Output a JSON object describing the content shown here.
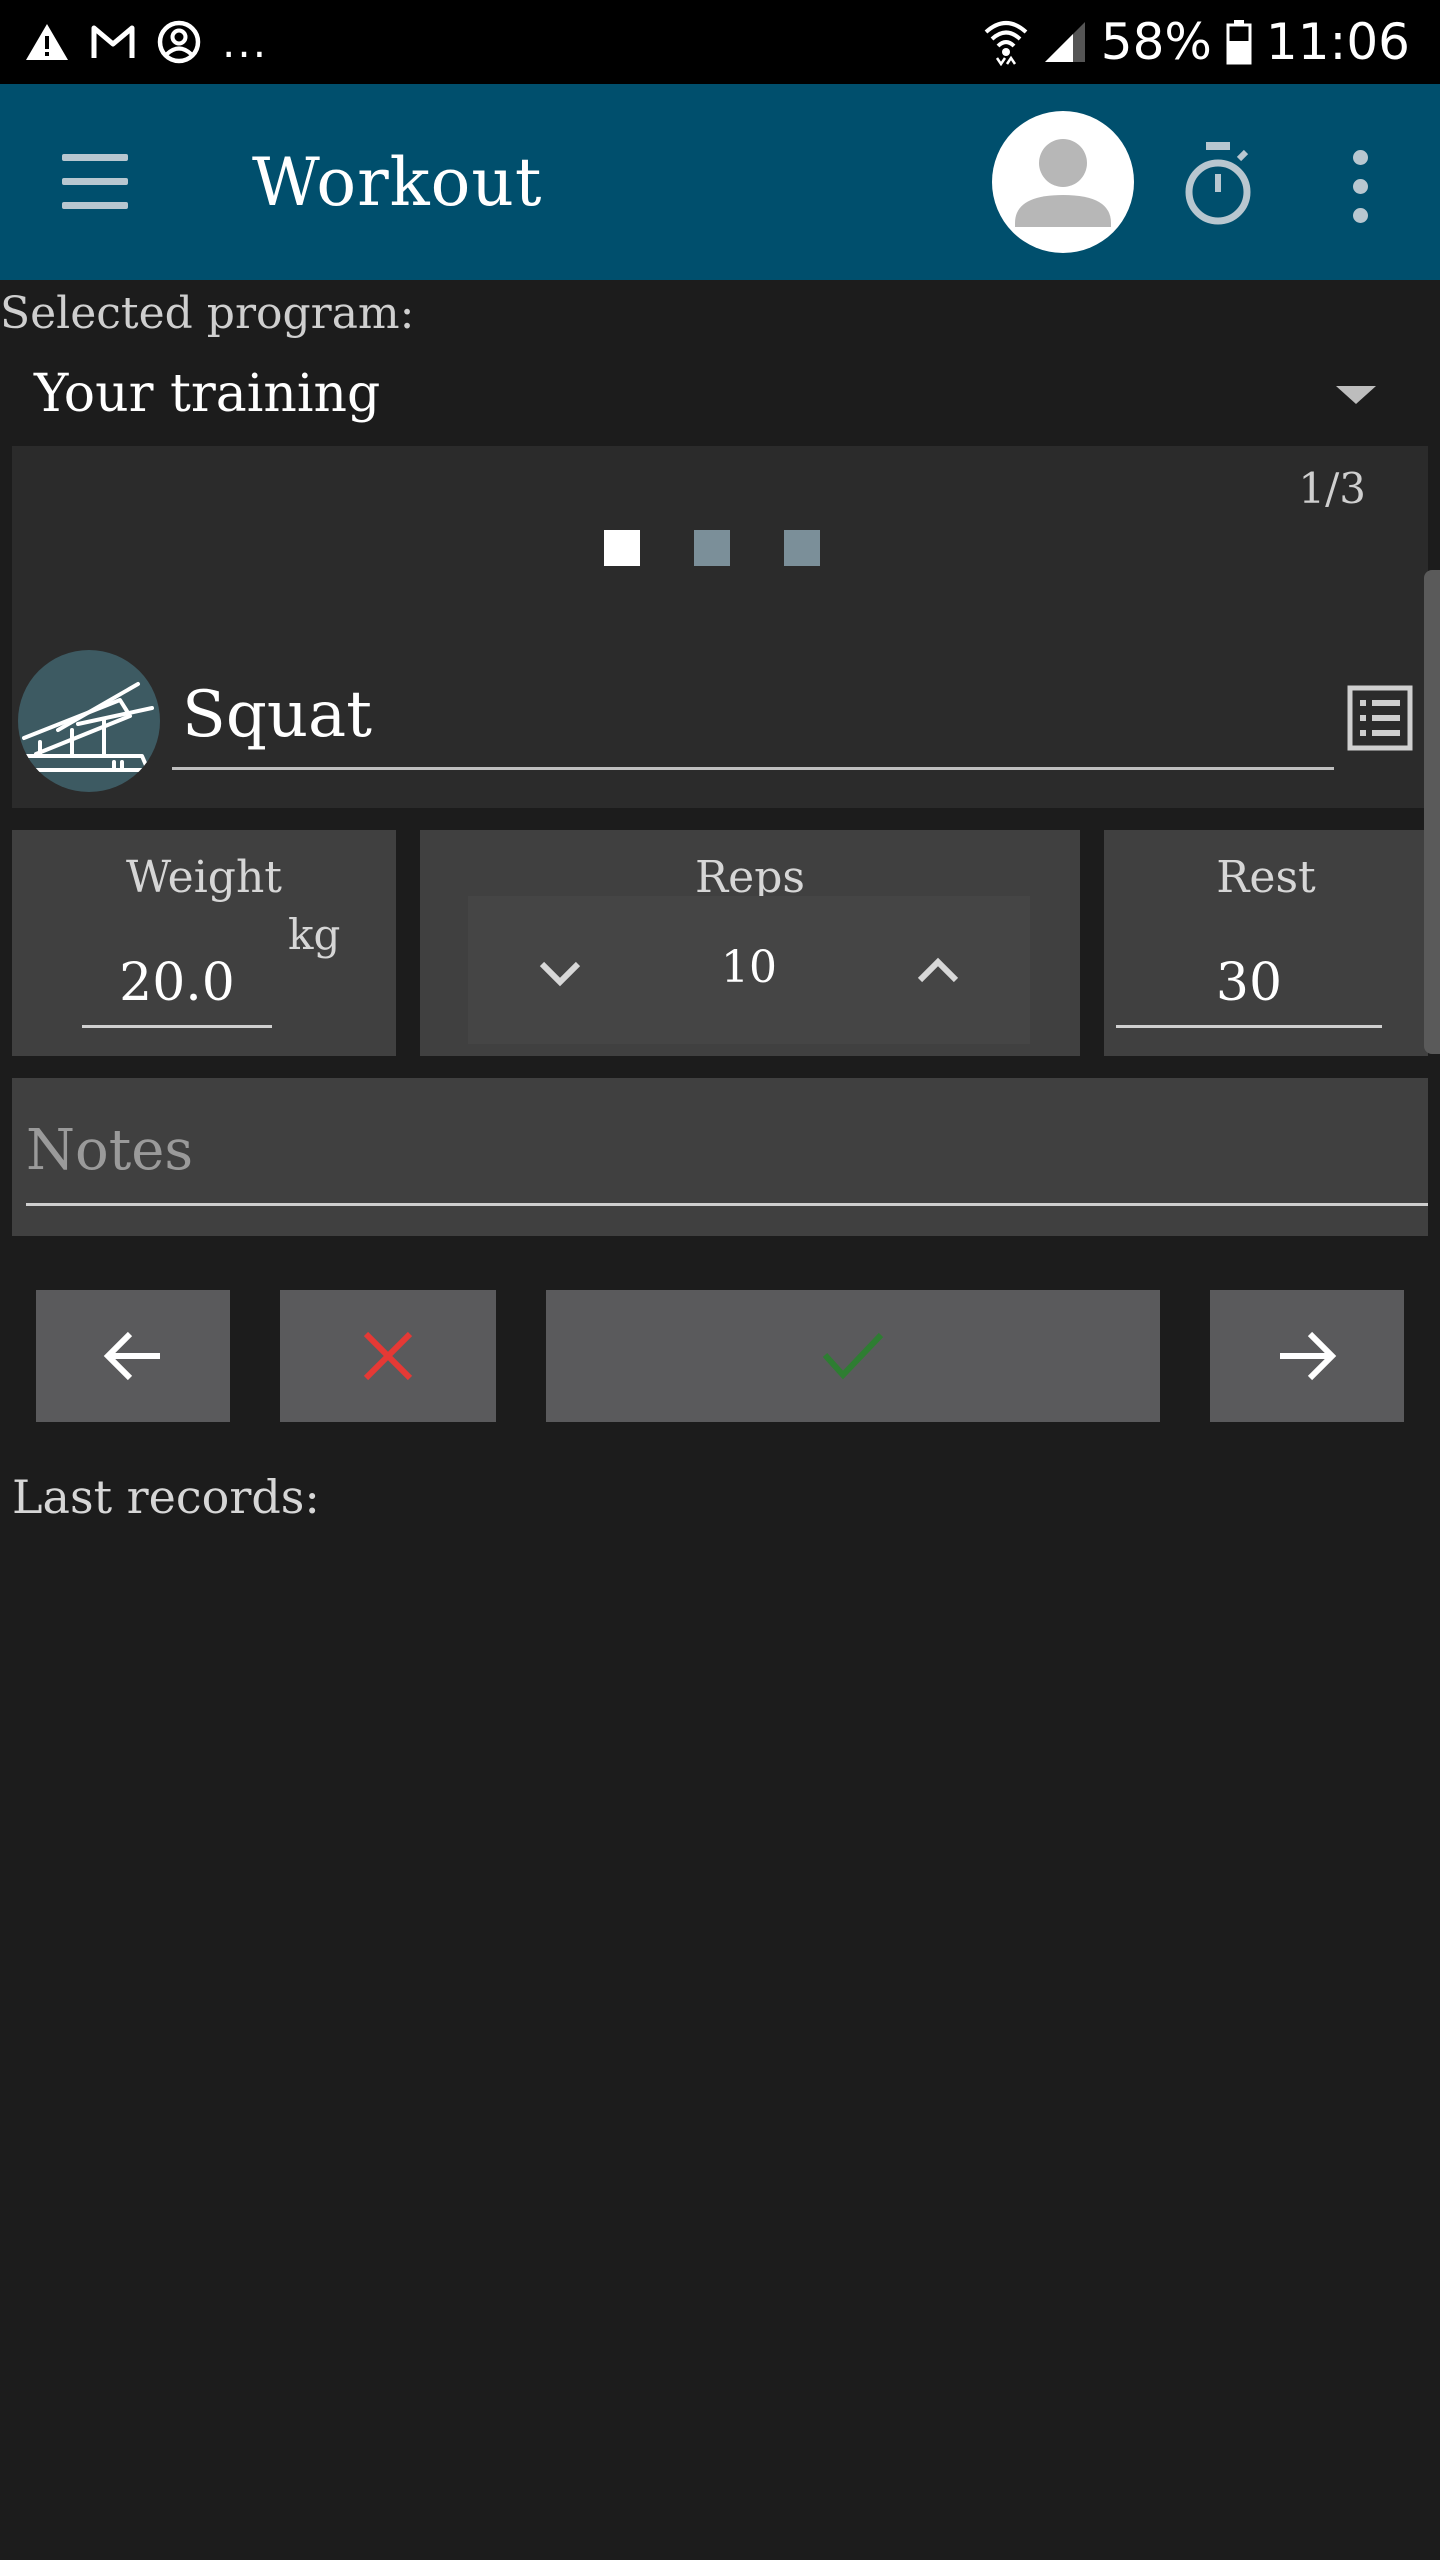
{
  "status_bar": {
    "battery": "58%",
    "time": "11:06",
    "more_notifications": "..."
  },
  "app_bar": {
    "title": "Workout"
  },
  "program": {
    "label": "Selected program:",
    "value": "Your training"
  },
  "exercise": {
    "counter": "1/3",
    "pages_total": 3,
    "current_page": 1,
    "name": "Squat"
  },
  "weight": {
    "label": "Weight",
    "unit": "kg",
    "value": "20.0"
  },
  "reps": {
    "label": "Reps",
    "value": "10"
  },
  "rest": {
    "label": "Rest",
    "value": "30"
  },
  "notes": {
    "placeholder": "Notes"
  },
  "records": {
    "label": "Last records:"
  },
  "colors": {
    "app_bar": "#004f6d",
    "background": "#1c1c1c",
    "cancel": "#e53935",
    "confirm": "#2e7d32"
  }
}
